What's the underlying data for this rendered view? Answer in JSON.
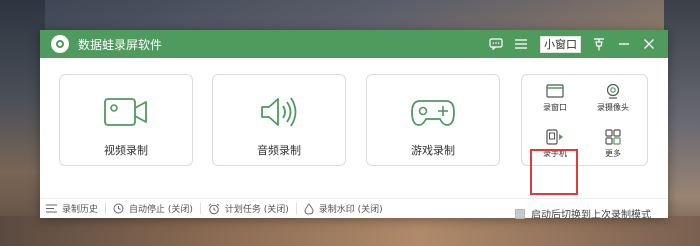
{
  "app": {
    "title": "数据蛙录屏软件",
    "mini_window_label": "小窗口",
    "accent_color": "#4f9a5d"
  },
  "cards": [
    {
      "label": "视频录制",
      "icon": "video-camera-icon"
    },
    {
      "label": "音频录制",
      "icon": "speaker-icon"
    },
    {
      "label": "游戏录制",
      "icon": "gamepad-icon"
    }
  ],
  "side_panel": {
    "items": [
      {
        "label": "录窗口",
        "icon": "window-icon"
      },
      {
        "label": "录摄像头",
        "icon": "webcam-icon"
      },
      {
        "label": "录手机",
        "icon": "phone-icon",
        "highlighted": true
      },
      {
        "label": "更多",
        "icon": "grid-icon"
      }
    ],
    "highlight_color": "#e23a3a"
  },
  "auto_switch": {
    "label": "启动后切换到上次录制模式",
    "checked": false
  },
  "footer": [
    {
      "label": "录制历史",
      "icon": "list-icon"
    },
    {
      "label": "自动停止 (关闭)",
      "icon": "clock-icon"
    },
    {
      "label": "计划任务 (关闭)",
      "icon": "alarm-icon"
    },
    {
      "label": "录制水印 (关闭)",
      "icon": "droplet-icon"
    }
  ]
}
